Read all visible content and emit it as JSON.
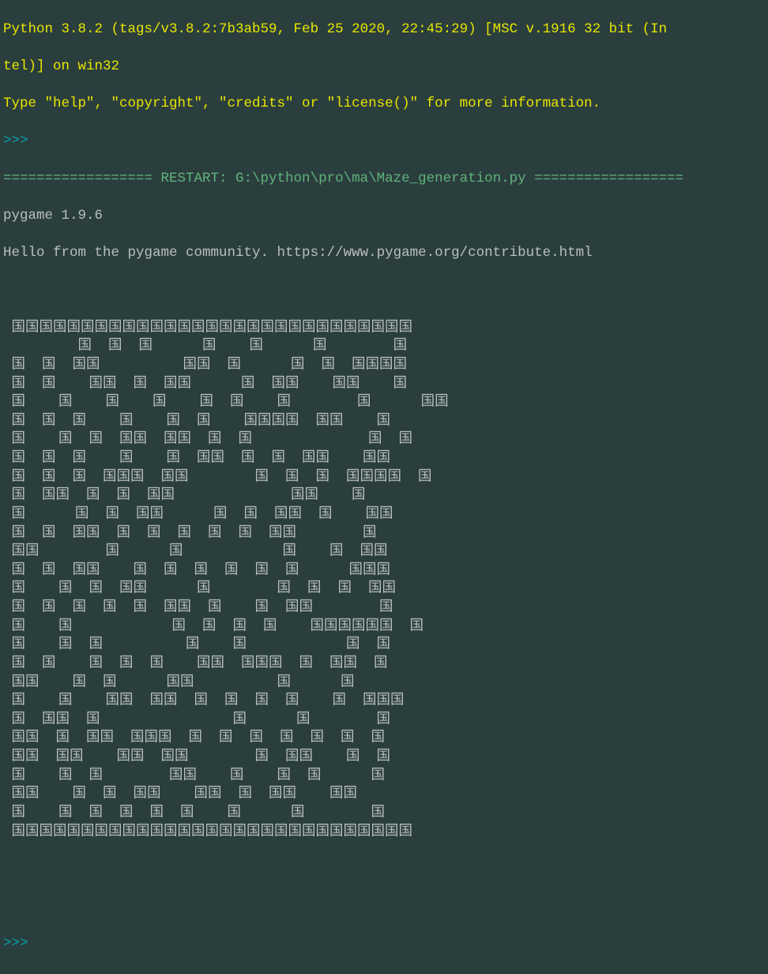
{
  "console": {
    "header_line1": "Python 3.8.2 (tags/v3.8.2:7b3ab59, Feb 25 2020, 22:45:29) [MSC v.1916 32 bit (In",
    "header_line2": "tel)] on win32",
    "header_line3": "Type \"help\", \"copyright\", \"credits\" or \"license()\" for more information.",
    "prompt1": ">>> ",
    "restart_line": "================== RESTART: G:\\python\\pro\\ma\\Maze_generation.py ==================",
    "pygame_line1": "pygame 1.9.6",
    "pygame_line2": "Hello from the pygame community. https://www.pygame.org/contribute.html",
    "prompt2": ">>> "
  },
  "maze": {
    "wall_char": "国",
    "rows": [
      " 国国国国国国国国国国国国国国国国国国国国国国国国国国国国国",
      "         国  国  国      国    国      国        国",
      " 国  国  国国          国国  国      国  国  国国国国",
      " 国  国    国国  国  国国      国  国国    国国    国",
      " 国    国    国    国    国  国    国        国      国国",
      " 国  国  国    国    国  国    国国国国  国国    国",
      " 国    国  国  国国  国国  国  国              国  国",
      " 国  国  国    国    国  国国  国  国  国国    国国",
      " 国  国  国  国国国  国国        国  国  国  国国国国  国",
      " 国  国国  国  国  国国              国国    国",
      " 国      国  国  国国      国  国  国国  国    国国",
      " 国  国  国国  国  国  国  国  国  国国        国",
      " 国国        国      国            国    国  国国",
      " 国  国  国国    国  国  国  国  国  国      国国国",
      " 国    国  国  国国      国        国  国  国  国国",
      " 国  国  国  国  国  国国  国    国  国国        国",
      " 国    国            国  国  国  国    国国国国国国  国",
      " 国    国  国          国    国            国  国",
      " 国  国    国  国  国    国国  国国国  国  国国  国",
      " 国国    国  国      国国          国      国",
      " 国    国    国国  国国  国  国  国  国    国  国国国",
      " 国  国国  国                国      国        国",
      " 国国  国  国国  国国国  国  国  国  国  国  国  国",
      " 国国  国国    国国  国国        国  国国    国  国",
      " 国    国  国        国国    国    国  国      国",
      " 国国    国  国  国国    国国  国  国国    国国",
      " 国    国  国  国  国  国    国      国        国",
      " 国国国国国国国国国国国国国国国国国国国国国国国国国国国国国"
    ]
  }
}
